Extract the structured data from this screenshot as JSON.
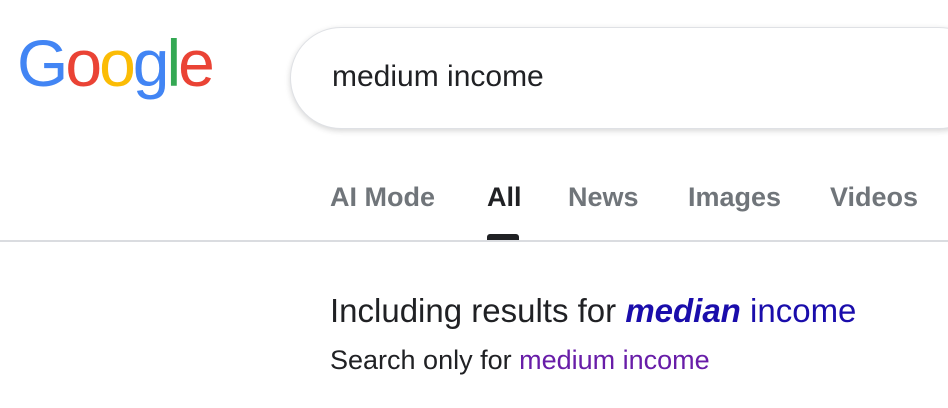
{
  "logo": {
    "letters": [
      {
        "char": "G",
        "color": "#4285F4"
      },
      {
        "char": "o",
        "color": "#EA4335"
      },
      {
        "char": "o",
        "color": "#FBBC05"
      },
      {
        "char": "g",
        "color": "#4285F4"
      },
      {
        "char": "l",
        "color": "#34A853"
      },
      {
        "char": "e",
        "color": "#EA4335"
      }
    ]
  },
  "search": {
    "value": "medium income"
  },
  "tabs": [
    {
      "label": "AI Mode",
      "active": false
    },
    {
      "label": "All",
      "active": true
    },
    {
      "label": "News",
      "active": false
    },
    {
      "label": "Images",
      "active": false
    },
    {
      "label": "Videos",
      "active": false
    }
  ],
  "correction": {
    "prefix": "Including results for ",
    "corrected_word": "median",
    "rest": " income",
    "search_only_prefix": "Search only for ",
    "search_only_query": "medium income"
  },
  "colors": {
    "link": "#1a0dab",
    "visited_link": "#681da8",
    "text": "#202124",
    "tab_inactive": "#70757a"
  }
}
